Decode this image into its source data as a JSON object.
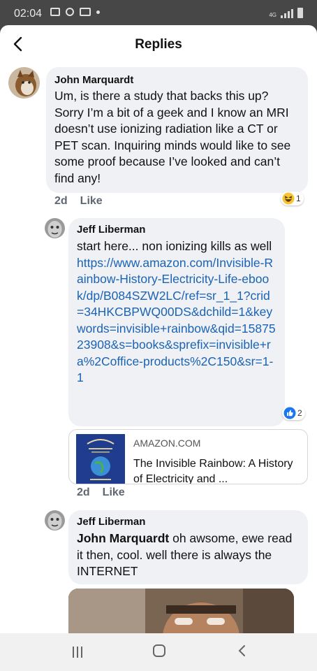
{
  "status": {
    "time": "02:04",
    "network": "4G"
  },
  "header": {
    "title": "Replies"
  },
  "comments": [
    {
      "author": "John Marquardt",
      "text": "Um, is there a study that backs this up? Sorry I’m a bit of a geek and I know an MRI doesn’t use ionizing radiation like a CT or PET scan. Inquiring minds would like to see some proof because I’ve looked and can’t find any!",
      "age": "2d",
      "like_label": "Like",
      "reaction": {
        "icon": "haha-emoji-icon",
        "count": "1"
      }
    },
    {
      "author": "Jeff Liberman",
      "text": "start here... non ionizing kills as well",
      "link": "https://www.amazon.com/Invisible-Rainbow-History-Electricity-Life-ebook/dp/B084SZW2LC/ref=sr_1_1?crid=34HKCBPWQ00DS&dchild=1&keywords=invisible+rainbow&qid=1587523908&s=books&sprefix=invisible+ra%2Coffice-products%2C150&sr=1-1",
      "preview": {
        "domain": "AMAZON.COM",
        "title": "The Invisible Rainbow: A History of Electricity and ..."
      },
      "age": "2d",
      "like_label": "Like",
      "reaction": {
        "icon": "like-thumb-icon",
        "count": "2"
      }
    },
    {
      "author": "Jeff Liberman",
      "mention": "John Marquardt",
      "text": " oh awsome, ewe read it then, cool.  well there is always the INTERNET"
    }
  ],
  "colors": {
    "bubble": "#eff1f4",
    "link": "#1b63b5",
    "like_blue": "#1877f2"
  }
}
